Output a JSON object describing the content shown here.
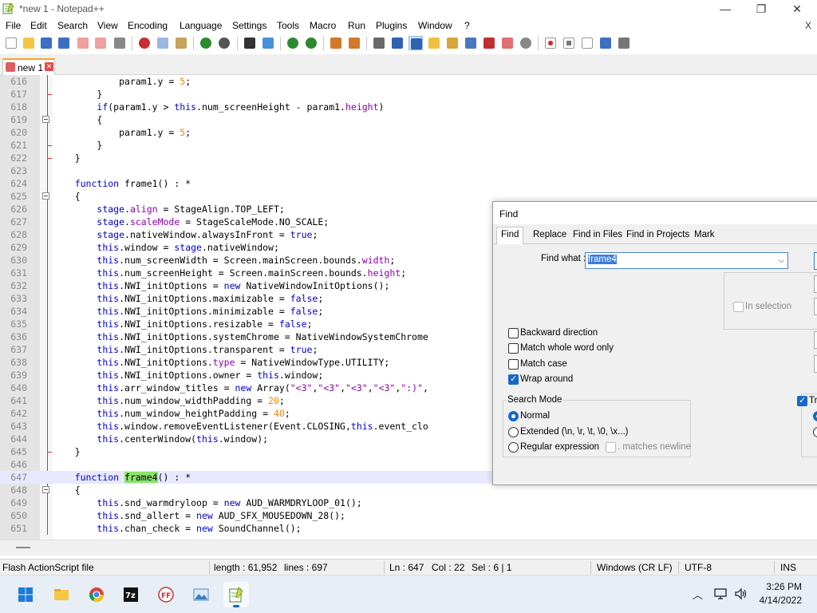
{
  "window": {
    "title": "*new 1 - Notepad++",
    "minimize_glyph": "—",
    "maximize_glyph": "❐",
    "close_glyph": "✕"
  },
  "menu": {
    "items": [
      "File",
      "Edit",
      "Search",
      "View",
      "Encoding",
      "Language",
      "Settings",
      "Tools",
      "Macro",
      "Run",
      "Plugins",
      "Window",
      "?"
    ],
    "close_label": "X"
  },
  "tabs": [
    {
      "label": "new 1",
      "close_glyph": "✕"
    }
  ],
  "editor": {
    "lines": [
      {
        "n": "616",
        "code": "            param1.y = 5;"
      },
      {
        "n": "617",
        "code": "        }"
      },
      {
        "n": "618",
        "code": "        if(param1.y > this.num_screenHeight - param1.height)"
      },
      {
        "n": "619",
        "code": "        {"
      },
      {
        "n": "620",
        "code": "            param1.y = 5;"
      },
      {
        "n": "621",
        "code": "        }"
      },
      {
        "n": "622",
        "code": "    }"
      },
      {
        "n": "623",
        "code": ""
      },
      {
        "n": "624",
        "code": "    function frame1() : *"
      },
      {
        "n": "625",
        "code": "    {"
      },
      {
        "n": "626",
        "code": "        stage.align = StageAlign.TOP_LEFT;"
      },
      {
        "n": "627",
        "code": "        stage.scaleMode = StageScaleMode.NO_SCALE;"
      },
      {
        "n": "628",
        "code": "        stage.nativeWindow.alwaysInFront = true;"
      },
      {
        "n": "629",
        "code": "        this.window = stage.nativeWindow;"
      },
      {
        "n": "630",
        "code": "        this.num_screenWidth = Screen.mainScreen.bounds.width;"
      },
      {
        "n": "631",
        "code": "        this.num_screenHeight = Screen.mainScreen.bounds.height;"
      },
      {
        "n": "632",
        "code": "        this.NWI_initOptions = new NativeWindowInitOptions();"
      },
      {
        "n": "633",
        "code": "        this.NWI_initOptions.maximizable = false;"
      },
      {
        "n": "634",
        "code": "        this.NWI_initOptions.minimizable = false;"
      },
      {
        "n": "635",
        "code": "        this.NWI_initOptions.resizable = false;"
      },
      {
        "n": "636",
        "code": "        this.NWI_initOptions.systemChrome = NativeWindowSystemChrome"
      },
      {
        "n": "637",
        "code": "        this.NWI_initOptions.transparent = true;"
      },
      {
        "n": "638",
        "code": "        this.NWI_initOptions.type = NativeWindowType.UTILITY;"
      },
      {
        "n": "639",
        "code": "        this.NWI_initOptions.owner = this.window;"
      },
      {
        "n": "640",
        "code": "        this.arr_window_titles = new Array(\"<3\",\"<3\",\"<3\",\"<3\",\":)\","
      },
      {
        "n": "641",
        "code": "        this.num_window_widthPadding = 20;"
      },
      {
        "n": "642",
        "code": "        this.num_window_heightPadding = 40;"
      },
      {
        "n": "643",
        "code": "        this.window.removeEventListener(Event.CLOSING,this.event_clo"
      },
      {
        "n": "644",
        "code": "        this.centerWindow(this.window);"
      },
      {
        "n": "645",
        "code": "    }"
      },
      {
        "n": "646",
        "code": ""
      },
      {
        "n": "647",
        "code": "    function frame4() : *"
      },
      {
        "n": "648",
        "code": "    {"
      },
      {
        "n": "649",
        "code": "        this.snd_warmdryloop = new AUD_WARMDRYLOOP_01();"
      },
      {
        "n": "650",
        "code": "        this.snd_allert = new AUD_SFX_MOUSEDOWN_28();"
      },
      {
        "n": "651",
        "code": "        this.chan_check = new SoundChannel();"
      }
    ]
  },
  "status": {
    "file_type": "Flash ActionScript file",
    "length": "length : 61,952",
    "lines": "lines : 697",
    "ln": "Ln : 647",
    "col": "Col : 22",
    "sel": "Sel : 6 | 1",
    "eol": "Windows (CR LF)",
    "encoding": "UTF-8",
    "mode": "INS"
  },
  "find_dialog": {
    "title": "Find",
    "tabs": [
      "Find",
      "Replace",
      "Find in Files",
      "Find in Projects",
      "Mark"
    ],
    "find_what_label": "Find what :",
    "find_what_value": "frame4",
    "in_selection_label": "In selection",
    "options": [
      {
        "label": "Backward direction",
        "checked": false
      },
      {
        "label": "Match whole word only",
        "checked": false
      },
      {
        "label": "Match case",
        "checked": false
      },
      {
        "label": "Wrap around",
        "checked": true
      }
    ],
    "search_mode_title": "Search Mode",
    "modes": [
      {
        "label": "Normal",
        "selected": true
      },
      {
        "label": "Extended (\\n, \\r, \\t, \\0, \\x...)",
        "selected": false
      },
      {
        "label": "Regular expression",
        "selected": false
      }
    ],
    "matches_newline_label": ". matches newline",
    "transparency_label": "Tr"
  },
  "taskbar": {
    "time": "3:26 PM",
    "date": "4/14/2022",
    "apps": [
      "start-icon",
      "file-explorer-icon",
      "chrome-icon",
      "7zip-icon",
      "ffdec-icon",
      "photos-icon",
      "notepadpp-icon"
    ]
  },
  "colors": {
    "keyword": "#0000cc",
    "property": "#8b00b0",
    "number": "#ff8000",
    "find_highlight": "#8ae26a",
    "current_line": "#e8e8ff",
    "fold_line": "#e03030",
    "tab_accent": "#f7a427"
  }
}
